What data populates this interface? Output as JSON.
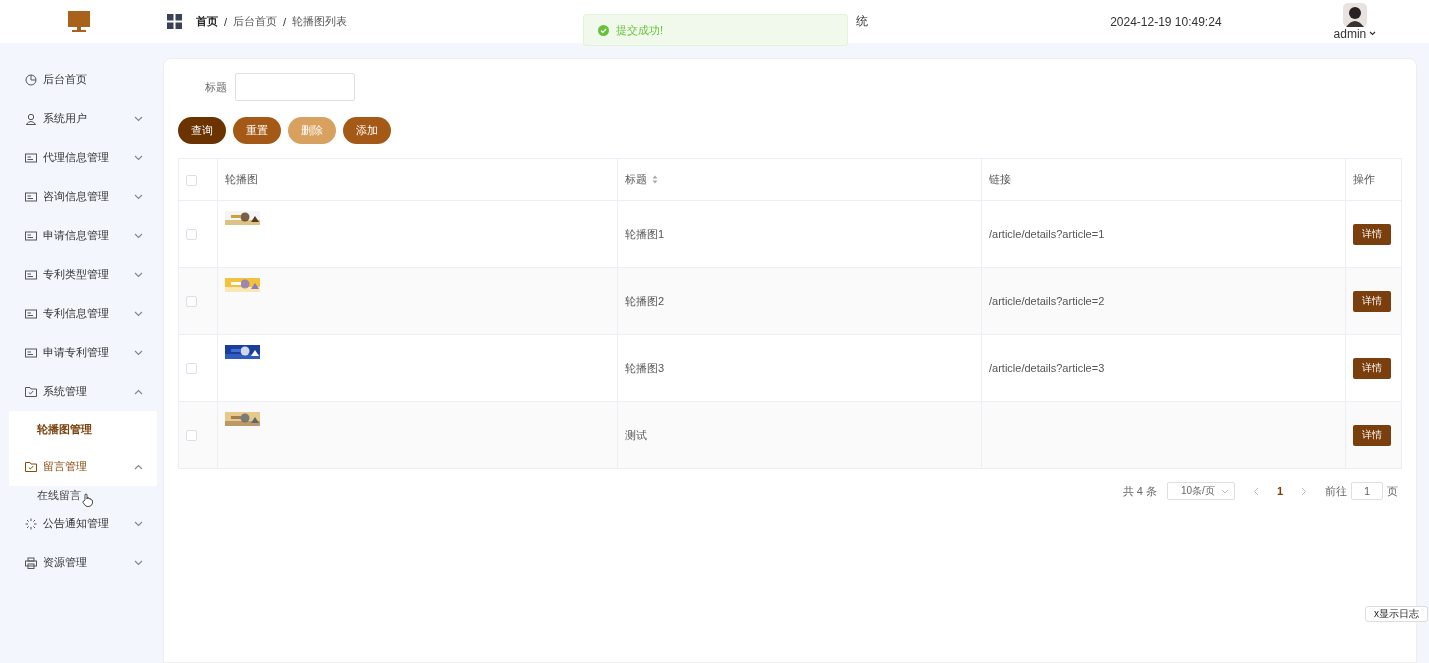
{
  "header": {
    "breadcrumb": [
      {
        "label": "首页",
        "current": true
      },
      {
        "label": "后台首页",
        "current": false
      },
      {
        "label": "轮播图列表",
        "current": false
      }
    ],
    "separator": "/",
    "title": "统",
    "datetime": "2024-12-19 10:49:24",
    "user": "admin"
  },
  "toast": {
    "message": "提交成功!"
  },
  "sidebar": {
    "items": [
      {
        "label": "后台首页",
        "highlighted": false
      },
      {
        "label": "系统用户",
        "expanded": false,
        "highlighted": false
      },
      {
        "label": "代理信息管理",
        "expanded": false,
        "highlighted": false
      },
      {
        "label": "咨询信息管理",
        "expanded": false,
        "highlighted": false
      },
      {
        "label": "申请信息管理",
        "expanded": false,
        "highlighted": false
      },
      {
        "label": "专利类型管理",
        "expanded": false,
        "highlighted": false
      },
      {
        "label": "专利信息管理",
        "expanded": false,
        "highlighted": false
      },
      {
        "label": "申请专利管理",
        "expanded": false,
        "highlighted": false
      },
      {
        "label": "系统管理",
        "expanded": true,
        "highlighted": false,
        "children": [
          {
            "label": "轮播图管理",
            "selected": true
          }
        ]
      },
      {
        "label": "留言管理",
        "expanded": true,
        "highlighted": true,
        "children": [
          {
            "label": "在线留言",
            "selected": false
          }
        ]
      },
      {
        "label": "公告通知管理",
        "expanded": false,
        "highlighted": false
      },
      {
        "label": "资源管理",
        "expanded": false,
        "highlighted": false
      }
    ]
  },
  "search": {
    "label": "标题"
  },
  "buttons": [
    {
      "label": "查询",
      "kind": "primary",
      "disabled": false
    },
    {
      "label": "重置",
      "kind": "normal",
      "disabled": false
    },
    {
      "label": "删除",
      "kind": "normal",
      "disabled": true
    },
    {
      "label": "添加",
      "kind": "normal",
      "disabled": false
    }
  ],
  "table": {
    "all_checked": false,
    "columns": [
      "轮播图",
      "标题",
      "链接",
      "操作"
    ],
    "rows": [
      {
        "checked": false,
        "title": "轮播图1",
        "link": "/article/details?article=1",
        "action": "详情"
      },
      {
        "checked": false,
        "title": "轮播图2",
        "link": "/article/details?article=2",
        "action": "详情"
      },
      {
        "checked": false,
        "title": "轮播图3",
        "link": "/article/details?article=3",
        "action": "详情"
      },
      {
        "checked": false,
        "title": "测试",
        "action": "详情"
      }
    ]
  },
  "pagination": {
    "total": "共 4 条",
    "page_size": "10条/页",
    "pages": [
      {
        "label": "1",
        "selected": true
      }
    ],
    "goto_label": "前往",
    "goto_value": "1",
    "goto_suffix": "页"
  },
  "log_button": "x显示日志"
}
